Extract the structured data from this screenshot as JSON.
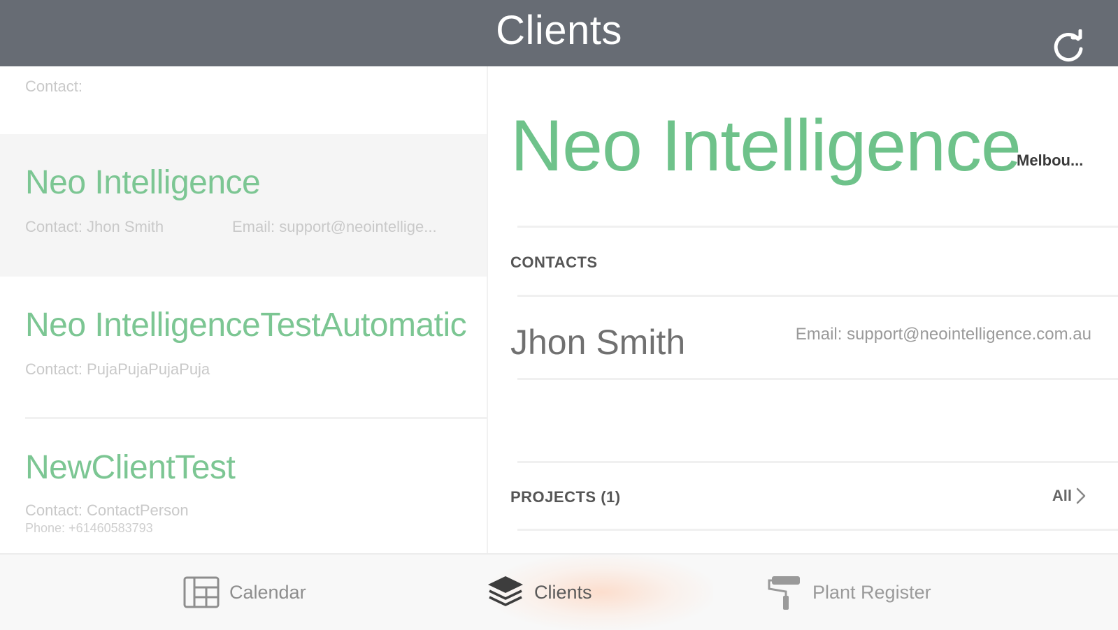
{
  "header": {
    "title": "Clients"
  },
  "list": {
    "top_partial_contact": "Contact:",
    "items": [
      {
        "name": "Neo Intelligence",
        "contact": "Contact: Jhon Smith",
        "email": "Email: support@neointellige..."
      },
      {
        "name": "Neo IntelligenceTestAutomatic",
        "contact": "Contact: PujaPujaPujaPuja"
      },
      {
        "name": "NewClientTest",
        "contact": "Contact: ContactPerson",
        "phone": "Phone: +61460583793"
      }
    ]
  },
  "detail": {
    "name": "Neo Intelligence",
    "city": "Melbou...",
    "contacts_header": "CONTACTS",
    "contact_name": "Jhon Smith",
    "contact_email": "Email: support@neointelligence.com.au",
    "projects_header": "PROJECTS (1)",
    "all_label": "All"
  },
  "tabs": [
    {
      "label": "Calendar",
      "icon": "calendar-icon"
    },
    {
      "label": "Clients",
      "icon": "layers-icon"
    },
    {
      "label": "Plant Register",
      "icon": "paint-roller-icon"
    }
  ],
  "colors": {
    "header_bg": "#676c74",
    "accent_green": "#7cc693",
    "selected_row": "#f5f5f5"
  }
}
